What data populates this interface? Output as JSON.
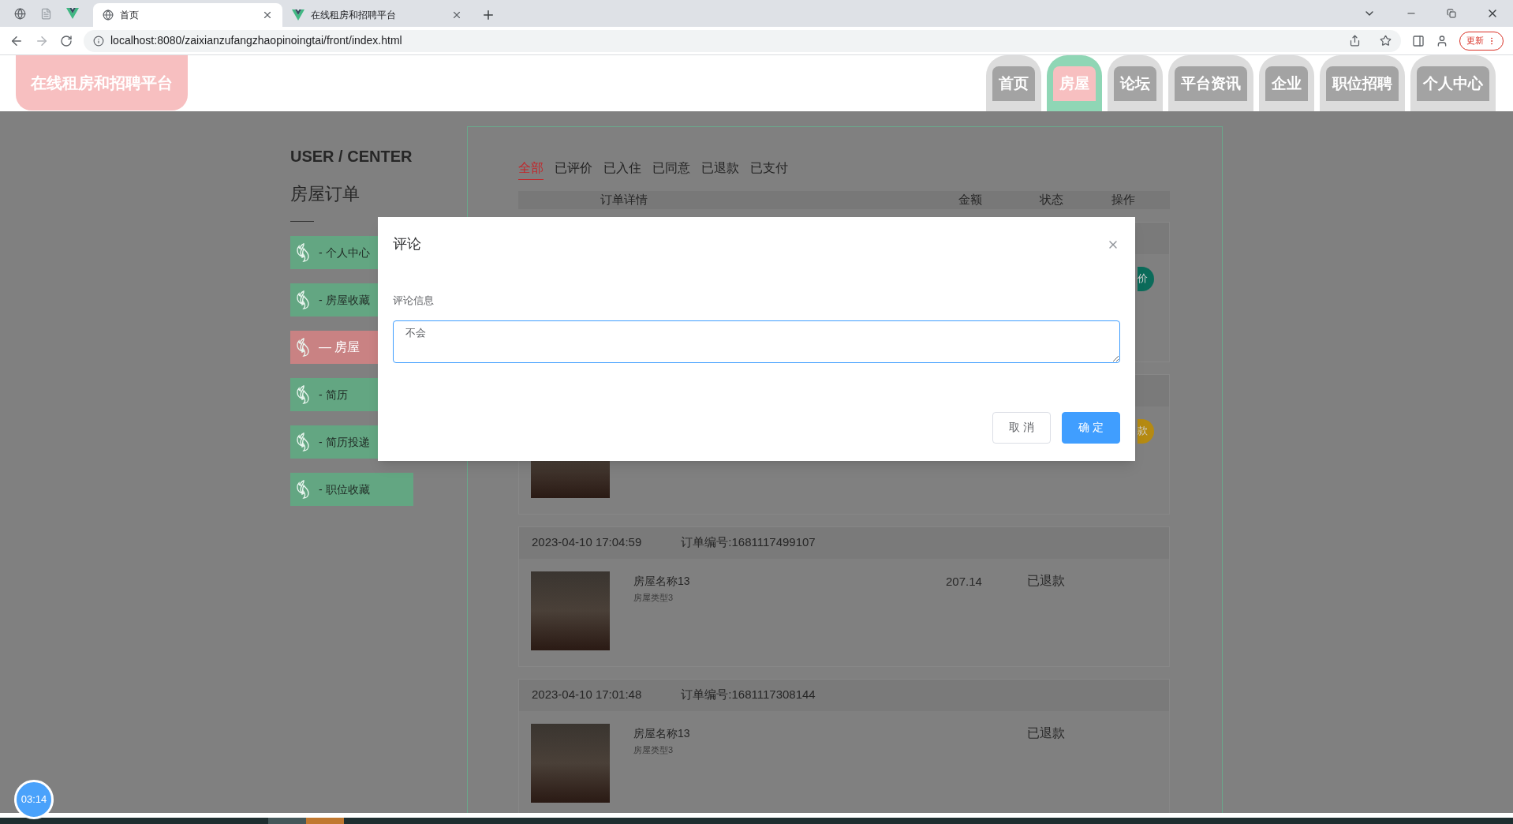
{
  "browser": {
    "tabs": [
      {
        "title": "首页",
        "selected": true
      },
      {
        "title": "在线租房和招聘平台",
        "selected": false
      }
    ],
    "url": "localhost:8080/zaixianzufangzhaopinoingtai/front/index.html",
    "update_button": "更新"
  },
  "header": {
    "logo": "在线租房和招聘平台",
    "nav": [
      {
        "label": "首页",
        "selected": false
      },
      {
        "label": "房屋",
        "selected": true
      },
      {
        "label": "论坛",
        "selected": false
      },
      {
        "label": "平台资讯",
        "selected": false
      },
      {
        "label": "企业",
        "selected": false
      },
      {
        "label": "职位招聘",
        "selected": false
      },
      {
        "label": "个人中心",
        "selected": false
      }
    ]
  },
  "sidebar": {
    "heading": "USER / CENTER",
    "title": "房屋订单",
    "items": [
      {
        "prefix": "-",
        "label": "个人中心",
        "selected": false
      },
      {
        "prefix": "-",
        "label": "房屋收藏",
        "selected": false
      },
      {
        "prefix": "—",
        "label": "房屋",
        "selected": true
      },
      {
        "prefix": "-",
        "label": "简历",
        "selected": false
      },
      {
        "prefix": "-",
        "label": "简历投递",
        "selected": false
      },
      {
        "prefix": "-",
        "label": "职位收藏",
        "selected": false
      }
    ]
  },
  "order_tabs": [
    {
      "label": "全部",
      "selected": true
    },
    {
      "label": "已评价",
      "selected": false
    },
    {
      "label": "已入住",
      "selected": false
    },
    {
      "label": "已同意",
      "selected": false
    },
    {
      "label": "已退款",
      "selected": false
    },
    {
      "label": "已支付",
      "selected": false
    }
  ],
  "table": {
    "columns": [
      "订单详情",
      "金额",
      "状态",
      "操作"
    ]
  },
  "orders": [
    {
      "action": {
        "label": "价",
        "color": "#0b6b5a"
      }
    },
    {
      "action": {
        "label": "款",
        "color": "#b58a12"
      }
    },
    {
      "time": "2023-04-10 17:04:59",
      "number": "订单编号:1681117499107",
      "name": "房屋名称13",
      "type": "房屋类型3",
      "price": "207.14",
      "status": "已退款"
    },
    {
      "time": "2023-04-10 17:01:48",
      "number": "订单编号:1681117308144",
      "name": "房屋名称13",
      "type": "房屋类型3",
      "status": "已退款"
    }
  ],
  "dialog": {
    "title": "评论",
    "field_label": "评论信息",
    "value": "不会",
    "buttons": [
      {
        "label": "取 消",
        "kind": "secondary"
      },
      {
        "label": "确 定",
        "kind": "primary"
      }
    ]
  },
  "timer": "03:14"
}
